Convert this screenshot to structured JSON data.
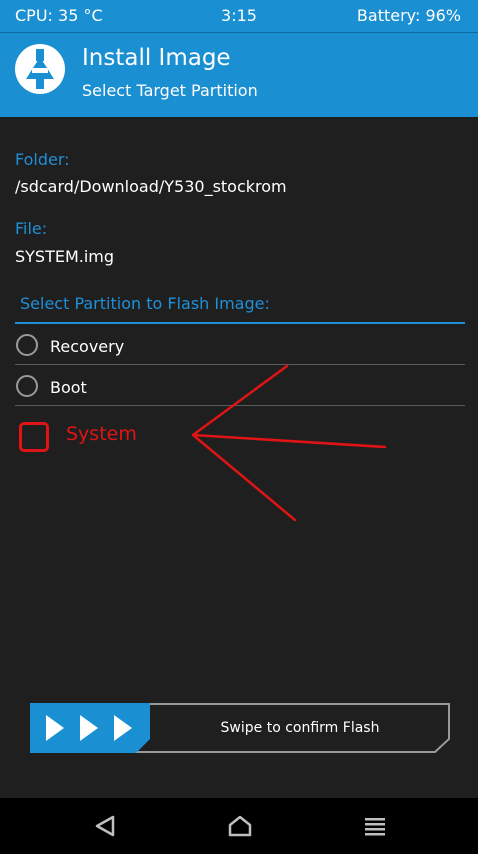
{
  "status": {
    "cpu": "CPU: 35 °C",
    "time": "3:15",
    "battery": "Battery: 96%"
  },
  "header": {
    "logo_icon": "twrp-logo-icon",
    "title": "Install Image",
    "subtitle": "Select Target Partition"
  },
  "folder": {
    "label": "Folder:",
    "value": "/sdcard/Download/Y530_stockrom"
  },
  "file": {
    "label": "File:",
    "value": "SYSTEM.img"
  },
  "partitions": {
    "title": "Select Partition to Flash Image:",
    "items": [
      {
        "label": "Recovery",
        "selected": false
      },
      {
        "label": "Boot",
        "selected": false
      },
      {
        "label": "System",
        "selected": false
      }
    ]
  },
  "swipe": {
    "label": "Swipe to confirm Flash"
  },
  "navbar": {
    "back_icon": "back-icon",
    "home_icon": "home-icon",
    "menu_icon": "menu-icon"
  },
  "colors": {
    "accent": "#1e90d8",
    "header": "#1a8fd1",
    "background": "#1f1f1f",
    "annotation": "#e01414"
  }
}
